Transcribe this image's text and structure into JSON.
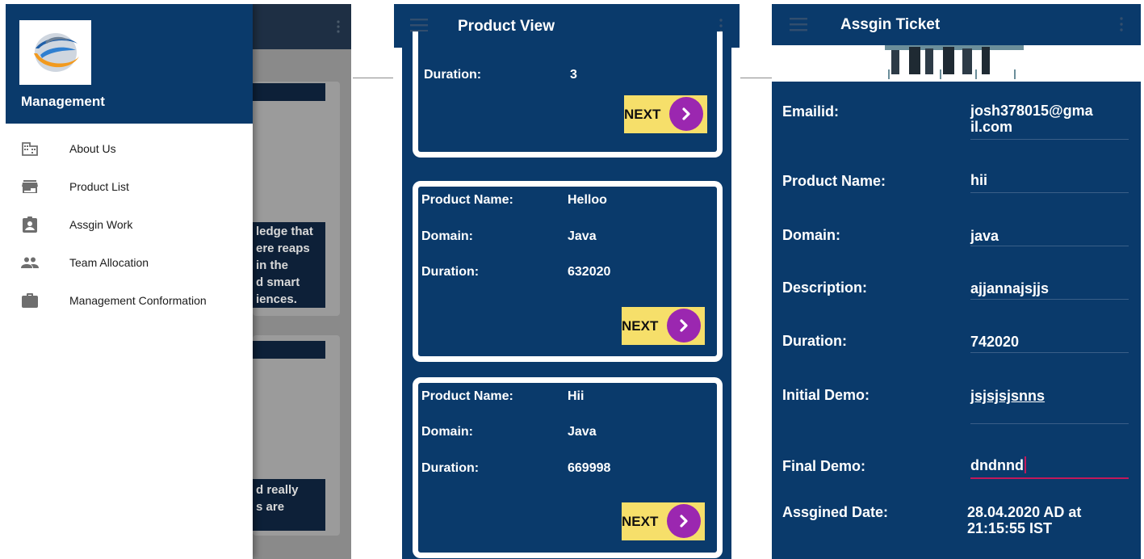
{
  "drawer": {
    "title": "Management",
    "items": [
      {
        "label": "About Us",
        "icon": "building-icon"
      },
      {
        "label": "Product List",
        "icon": "store-icon"
      },
      {
        "label": "Assgin Work",
        "icon": "assignment-ind-icon"
      },
      {
        "label": "Team Allocation",
        "icon": "people-icon"
      },
      {
        "label": "Management Conformation",
        "icon": "briefcase-icon"
      }
    ],
    "background_text": {
      "block1": "ledge that\nere reaps\nin the\nd smart\niences.",
      "block2": "d really\ns are"
    }
  },
  "product_view": {
    "title": "Product View",
    "next_label": "NEXT",
    "cards": [
      {
        "rows": [
          {
            "label": "Duration:",
            "value": "3"
          }
        ]
      },
      {
        "rows": [
          {
            "label": "Product Name:",
            "value": "Helloo"
          },
          {
            "label": "Domain:",
            "value": "Java"
          },
          {
            "label": "Duration:",
            "value": "632020"
          }
        ]
      },
      {
        "rows": [
          {
            "label": "Product Name:",
            "value": "Hii"
          },
          {
            "label": "Domain:",
            "value": "Java"
          },
          {
            "label": "Duration:",
            "value": "669998"
          }
        ]
      }
    ]
  },
  "assign_ticket": {
    "title": "Assgin Ticket",
    "fields": [
      {
        "label": "Emailid:",
        "value": "josh378015@gma\nil.com"
      },
      {
        "label": "Product Name:",
        "value": "hii"
      },
      {
        "label": "Domain:",
        "value": "java"
      },
      {
        "label": "Description:",
        "value": "ajjannajsjjs"
      },
      {
        "label": "Duration:",
        "value": "742020"
      },
      {
        "label": "Initial Demo:",
        "value": "jsjsjsjsnns"
      },
      {
        "label": "Final Demo:",
        "value": "dndnnd"
      },
      {
        "label": "Assgined Date:",
        "value": "28.04.2020 AD at\n21:15:55 IST"
      }
    ]
  },
  "colors": {
    "primary": "#0a3a6b",
    "next_button": "#f6df6a",
    "next_arrow": "#9b27b0",
    "accent_line": "#c2185b"
  }
}
